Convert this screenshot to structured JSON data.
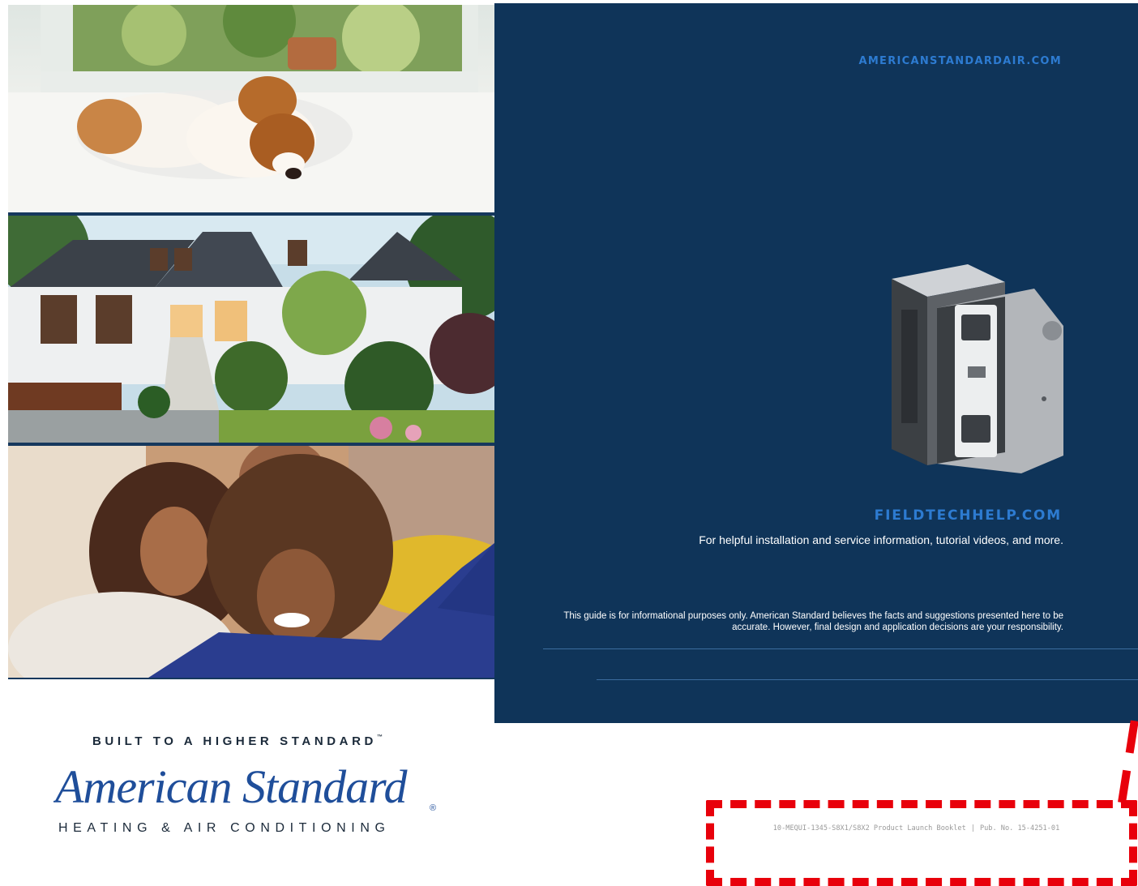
{
  "panel": {
    "website": "AMERICANSTANDARDAIR.COM",
    "fieldtech": "FIELDTECHHELP.COM",
    "fieldtech_desc": "For helpful installation and service information, tutorial videos, and more.",
    "disclaimer": "This guide is for informational purposes only. American Standard believes the facts and suggestions presented here to be accurate. However, final design and application decisions are your responsibility."
  },
  "brand": {
    "tagline": "BUILT TO A HIGHER STANDARD",
    "tagline_mark": "™",
    "name": "American Standard",
    "registered": "®",
    "subline": "HEATING & AIR CONDITIONING"
  },
  "publication": {
    "booklet": "10-MEQUI-1345-S8X1/S8X2 Product Launch Booklet",
    "separator": "|",
    "pub_no": "Pub. No. 15-4251-01"
  },
  "colors": {
    "panel": "#0f3459",
    "link": "#2d7bd1",
    "brand": "#1f4e9a",
    "highlight": "#e8000b"
  }
}
